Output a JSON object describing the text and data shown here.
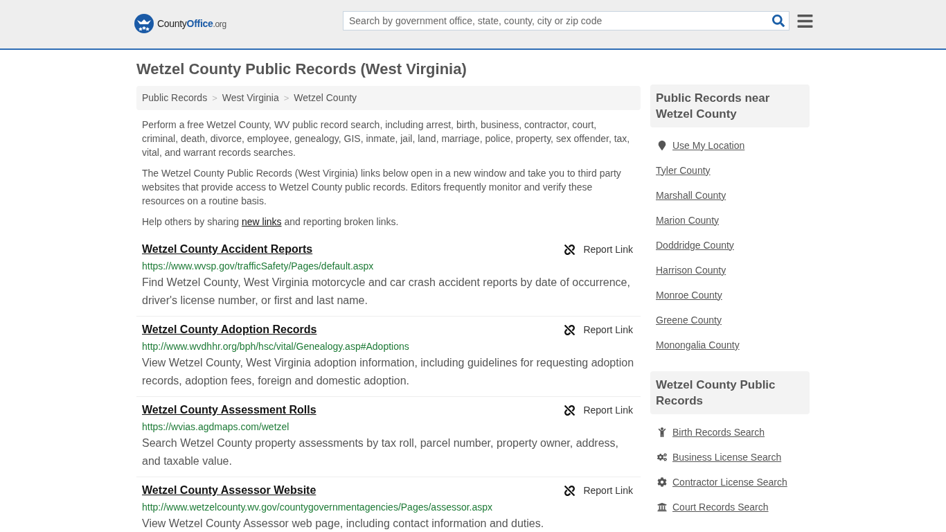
{
  "header": {
    "logo": {
      "name": "County",
      "highlight": "Office",
      "suffix": ".org"
    },
    "search": {
      "placeholder": "Search by government office, state, county, city or zip code"
    }
  },
  "page_title": "Wetzel County Public Records (West Virginia)",
  "breadcrumb": {
    "separator": ">",
    "items": [
      "Public Records",
      "West Virginia",
      "Wetzel County"
    ]
  },
  "intro": [
    "Perform a free Wetzel County, WV public record search, including arrest, birth, business, contractor, court, criminal, death, divorce, employee, genealogy, GIS, inmate, jail, land, marriage, police, property, sex offender, tax, vital, and warrant records searches.",
    "The Wetzel County Public Records (West Virginia) links below open in a new window and take you to third party websites that provide access to Wetzel County public records. Editors frequently monitor and verify these resources on a routine basis."
  ],
  "help_line": {
    "before": "Help others by sharing ",
    "link": "new links",
    "after": " and reporting broken links."
  },
  "listings": [
    {
      "title": "Wetzel County Accident Reports",
      "url": "https://www.wvsp.gov/trafficSafety/Pages/default.aspx",
      "description": "Find Wetzel County, West Virginia motorcycle and car crash accident reports by date of occurrence, driver's license number, or first and last name.",
      "action": "Report Link"
    },
    {
      "title": "Wetzel County Adoption Records",
      "url": "http://www.wvdhhr.org/bph/hsc/vital/Genealogy.asp#Adoptions",
      "description": "View Wetzel County, West Virginia adoption information, including guidelines for requesting adoption records, adoption fees, foreign and domestic adoption.",
      "action": "Report Link"
    },
    {
      "title": "Wetzel County Assessment Rolls",
      "url": "https://wvias.agdmaps.com/wetzel",
      "description": "Search Wetzel County property assessments by tax roll, parcel number, property owner, address, and taxable value.",
      "action": "Report Link"
    },
    {
      "title": "Wetzel County Assessor Website",
      "url": "http://www.wetzelcounty.wv.gov/countygovernmentagencies/Pages/assessor.aspx",
      "description": "View Wetzel County Assessor web page, including contact information and duties.",
      "action": "Report Link"
    }
  ],
  "sidebar": [
    {
      "heading": "Public Records near Wetzel County",
      "items": [
        {
          "label": "Use My Location",
          "kind": "location"
        },
        {
          "label": "Tyler County",
          "kind": "county"
        },
        {
          "label": "Marshall County",
          "kind": "county"
        },
        {
          "label": "Marion County",
          "kind": "county"
        },
        {
          "label": "Doddridge County",
          "kind": "county"
        },
        {
          "label": "Harrison County",
          "kind": "county"
        },
        {
          "label": "Monroe County",
          "kind": "county"
        },
        {
          "label": "Greene County",
          "kind": "county"
        },
        {
          "label": "Monongalia County",
          "kind": "county"
        }
      ]
    },
    {
      "heading": "Wetzel County Public Records",
      "items": [
        {
          "label": "Birth Records Search",
          "kind": "birth"
        },
        {
          "label": "Business License Search",
          "kind": "business"
        },
        {
          "label": "Contractor License Search",
          "kind": "contractor"
        },
        {
          "label": "Court Records Search",
          "kind": "court"
        }
      ]
    }
  ]
}
